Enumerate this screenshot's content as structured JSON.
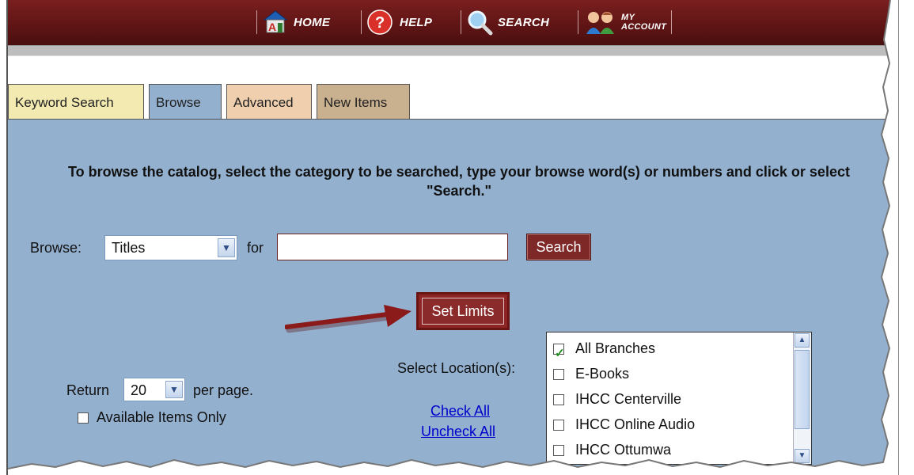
{
  "nav": {
    "home_label": "HOME",
    "help_label": "HELP",
    "search_label": "SEARCH",
    "account_label_line1": "MY",
    "account_label_line2": "ACCOUNT"
  },
  "tabs": [
    {
      "label": "Keyword Search"
    },
    {
      "label": "Browse"
    },
    {
      "label": "Advanced"
    },
    {
      "label": "New Items"
    }
  ],
  "instructions": "To browse the catalog, select the category to be searched, type your browse word(s) or numbers and click or select \"Search.\"",
  "browse": {
    "label": "Browse:",
    "category_selected": "Titles",
    "for_label": "for",
    "input_value": "",
    "search_button": "Search"
  },
  "set_limits_button": "Set Limits",
  "return": {
    "prefix": "Return",
    "selected": "20",
    "suffix": "per page."
  },
  "available_only_label": "Available Items Only",
  "locations": {
    "label": "Select Location(s):",
    "check_all": "Check All",
    "uncheck_all": "Uncheck All",
    "items": [
      {
        "label": "All Branches",
        "checked": true
      },
      {
        "label": "E-Books",
        "checked": false
      },
      {
        "label": "IHCC Centerville",
        "checked": false
      },
      {
        "label": "IHCC Online Audio",
        "checked": false
      },
      {
        "label": "IHCC Ottumwa",
        "checked": false
      }
    ]
  },
  "colors": {
    "topbar": "#5e1414",
    "panel": "#93b0cf",
    "button": "#7f2828",
    "arrow": "#8b1a1a"
  }
}
